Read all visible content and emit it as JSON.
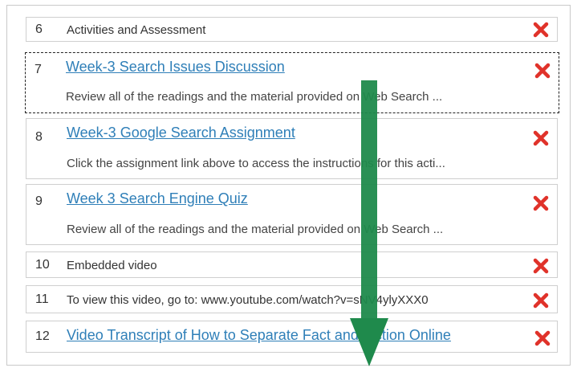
{
  "items": [
    {
      "number": "6",
      "title": "Activities and Assessment"
    },
    {
      "number": "7",
      "title": "Week-3 Search Issues Discussion",
      "description": "Review all of the readings and the material provided on Web Search ..."
    },
    {
      "number": "8",
      "title": "Week-3 Google Search Assignment",
      "description": "Click the assignment link above to access the instructions for this acti..."
    },
    {
      "number": "9",
      "title": "Week 3 Search Engine Quiz",
      "description": "Review all of the readings and the material provided on Web Search ..."
    },
    {
      "number": "10",
      "title": "Embedded video"
    },
    {
      "number": "11",
      "title": "To view this video, go to: www.youtube.com/watch?v=sNV4ylyXXX0"
    },
    {
      "number": "12",
      "title": "Video Transcript of How to Separate Fact and Fiction Online"
    }
  ],
  "icons": {
    "delete": "red-x-icon",
    "drag_arrow": "green-down-arrow-icon"
  },
  "colors": {
    "link": "#2f7fb8",
    "delete": "#e0322a",
    "arrow": "#1f8a4c"
  }
}
